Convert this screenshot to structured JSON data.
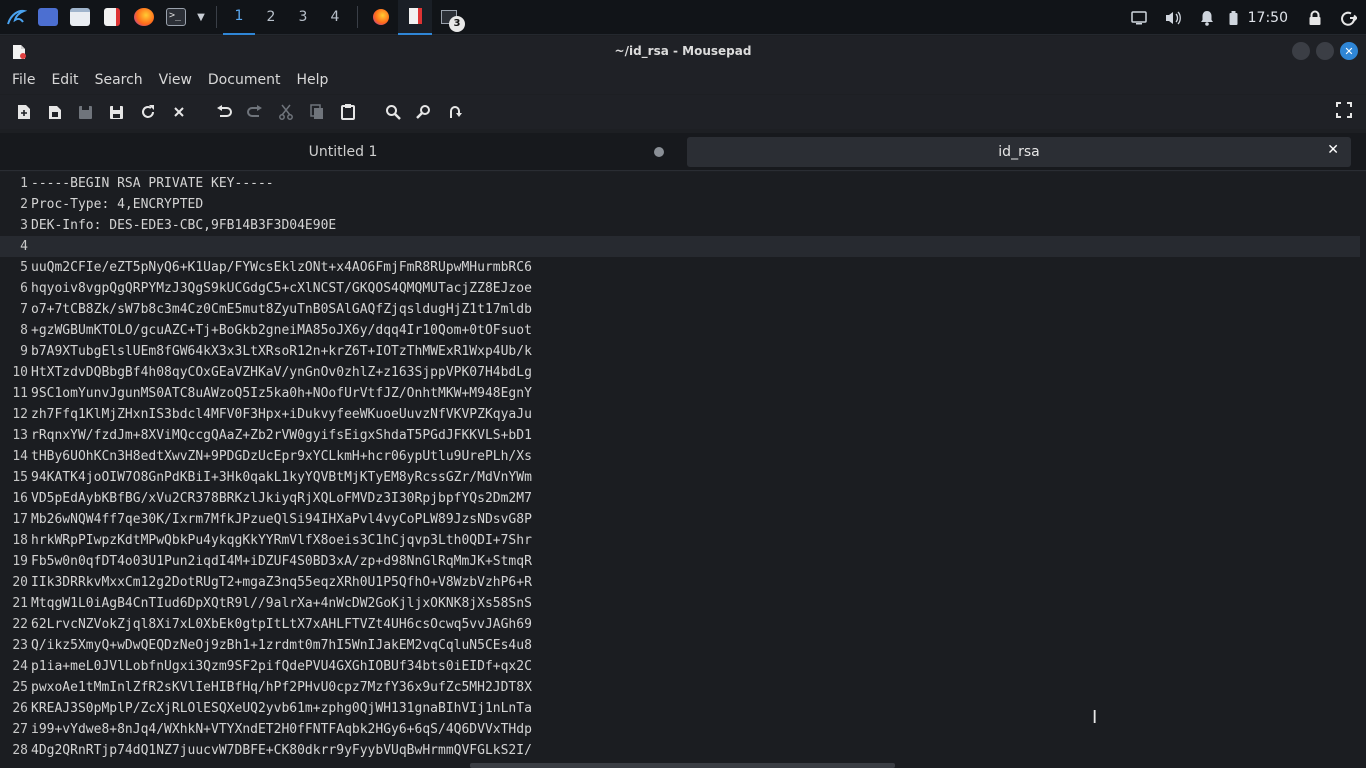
{
  "panel": {
    "workspaces": [
      "1",
      "2",
      "3",
      "4"
    ],
    "active_workspace": "1",
    "task_badge": "3",
    "clock": "17:50",
    "apps": [
      "kali-menu-icon",
      "terminal-window-icon",
      "file-manager-icon",
      "text-editor-icon",
      "firefox-icon",
      "terminal-icon"
    ]
  },
  "window": {
    "title": "~/id_rsa - Mousepad"
  },
  "menu": [
    "File",
    "Edit",
    "Search",
    "View",
    "Document",
    "Help"
  ],
  "toolbar": [
    "new-document-icon",
    "new-window-icon",
    "save-icon",
    "save-as-icon",
    "reload-icon",
    "close-document-icon",
    "undo-icon",
    "redo-icon",
    "cut-icon",
    "copy-icon",
    "paste-icon",
    "find-icon",
    "find-replace-icon",
    "goto-line-icon",
    "fullscreen-icon"
  ],
  "tabs": [
    {
      "label": "Untitled 1",
      "active": false
    },
    {
      "label": "id_rsa",
      "active": true
    }
  ],
  "editor": {
    "current_line": 4,
    "lines": [
      "-----BEGIN RSA PRIVATE KEY-----",
      "Proc-Type: 4,ENCRYPTED",
      "DEK-Info: DES-EDE3-CBC,9FB14B3F3D04E90E",
      "",
      "uuQm2CFIe/eZT5pNyQ6+K1Uap/FYWcsEklzONt+x4AO6FmjFmR8RUpwMHurmbRC6",
      "hqyoiv8vgpQgQRPYMzJ3QgS9kUCGdgC5+cXlNCST/GKQOS4QMQMUTacjZZ8EJzoe",
      "o7+7tCB8Zk/sW7b8c3m4Cz0CmE5mut8ZyuTnB0SAlGAQfZjqsldugHjZ1t17mldb",
      "+gzWGBUmKTOLO/gcuAZC+Tj+BoGkb2gneiMA85oJX6y/dqq4Ir10Qom+0tOFsuot",
      "b7A9XTubgElslUEm8fGW64kX3x3LtXRsoR12n+krZ6T+IOTzThMWExR1Wxp4Ub/k",
      "HtXTzdvDQBbgBf4h08qyCOxGEaVZHKaV/ynGnOv0zhlZ+z163SjppVPK07H4bdLg",
      "9SC1omYunvJgunMS0ATC8uAWzoQ5Iz5ka0h+NOofUrVtfJZ/OnhtMKW+M948EgnY",
      "zh7Ffq1KlMjZHxnIS3bdcl4MFV0F3Hpx+iDukvyfeeWKuoeUuvzNfVKVPZKqyaJu",
      "rRqnxYW/fzdJm+8XViMQccgQAaZ+Zb2rVW0gyifsEigxShdaT5PGdJFKKVLS+bD1",
      "tHBy6UOhKCn3H8edtXwvZN+9PDGDzUcEpr9xYCLkmH+hcr06ypUtlu9UrePLh/Xs",
      "94KATK4joOIW7O8GnPdKBiI+3Hk0qakL1kyYQVBtMjKTyEM8yRcssGZr/MdVnYWm",
      "VD5pEdAybKBfBG/xVu2CR378BRKzlJkiyqRjXQLoFMVDz3I30RpjbpfYQs2Dm2M7",
      "Mb26wNQW4ff7qe30K/Ixrm7MfkJPzueQlSi94IHXaPvl4vyCoPLW89JzsNDsvG8P",
      "hrkWRpPIwpzKdtMPwQbkPu4ykqgKkYYRmVlfX8oeis3C1hCjqvp3Lth0QDI+7Shr",
      "Fb5w0n0qfDT4o03U1Pun2iqdI4M+iDZUF4S0BD3xA/zp+d98NnGlRqMmJK+StmqR",
      "IIk3DRRkvMxxCm12g2DotRUgT2+mgaZ3nq55eqzXRh0U1P5QfhO+V8WzbVzhP6+R",
      "MtqgW1L0iAgB4CnTIud6DpXQtR9l//9alrXa+4nWcDW2GoKjljxOKNK8jXs58SnS",
      "62LrvcNZVokZjql8Xi7xL0XbEk0gtpItLtX7xAHLFTVZt4UH6csOcwq5vvJAGh69",
      "Q/ikz5XmyQ+wDwQEQDzNeOj9zBh1+1zrdmt0m7hI5WnIJakEM2vqCqluN5CEs4u8",
      "p1ia+meL0JVlLobfnUgxi3Qzm9SF2pifQdePVU4GXGhIOBUf34bts0iEIDf+qx2C",
      "pwxoAe1tMmInlZfR2sKVlIeHIBfHq/hPf2PHvU0cpz7MzfY36x9ufZc5MH2JDT8X",
      "KREAJ3S0pMplP/ZcXjRLOlESQXeUQ2yvb61m+zphg0QjWH131gnaBIhVIj1nLnTa",
      "i99+vYdwe8+8nJq4/WXhkN+VTYXndET2H0fFNTFAqbk2HGy6+6qS/4Q6DVVxTHdp",
      "4Dg2QRnRTjp74dQ1NZ7juucvW7DBFE+CK80dkrr9yFyybVUqBwHrmmQVFGLkS2I/"
    ]
  },
  "colors": {
    "accent": "#2f86d6",
    "background": "#1b1d21",
    "panel": "#111418"
  }
}
